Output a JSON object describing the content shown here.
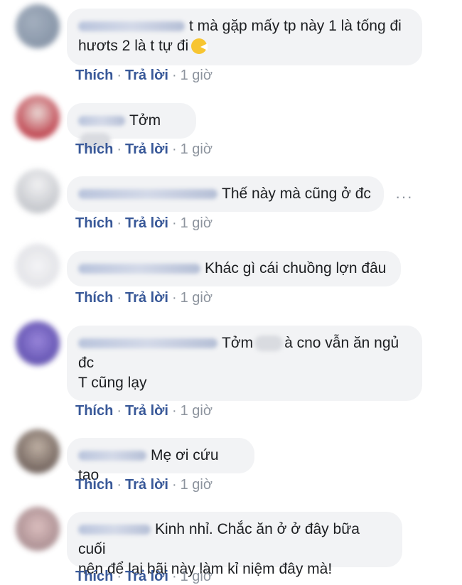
{
  "actions": {
    "like": "Thích",
    "reply": "Trả lời",
    "separator": "·"
  },
  "comments": [
    {
      "line1": "t mà gặp mấy tp này 1 là tống đi",
      "line2": "hươts 2 là t tự đi",
      "emoji": "emoji-grinning-icon",
      "time": "1 giờ"
    },
    {
      "text": "Tởm",
      "time": "1 giờ"
    },
    {
      "text": "Thế này mà cũng ở đc",
      "time": "1 giờ",
      "more": "···"
    },
    {
      "text": "Khác gì cái chuồng lợn đâu",
      "time": "1 giờ"
    },
    {
      "part1": "Tởm",
      "part2": "à cno vẫn ăn ngủ",
      "line2": "đc",
      "line3": "T cũng lạy",
      "time": "1 giờ"
    },
    {
      "text": "Mẹ ơi cứu tao",
      "time": "1 giờ"
    },
    {
      "line1": "Kinh nhỉ. Chắc ăn ở ở đây bữa cuối",
      "line2": "nên để lại bãi này làm kỉ niệm đây mà!",
      "time": "1 giờ"
    }
  ]
}
